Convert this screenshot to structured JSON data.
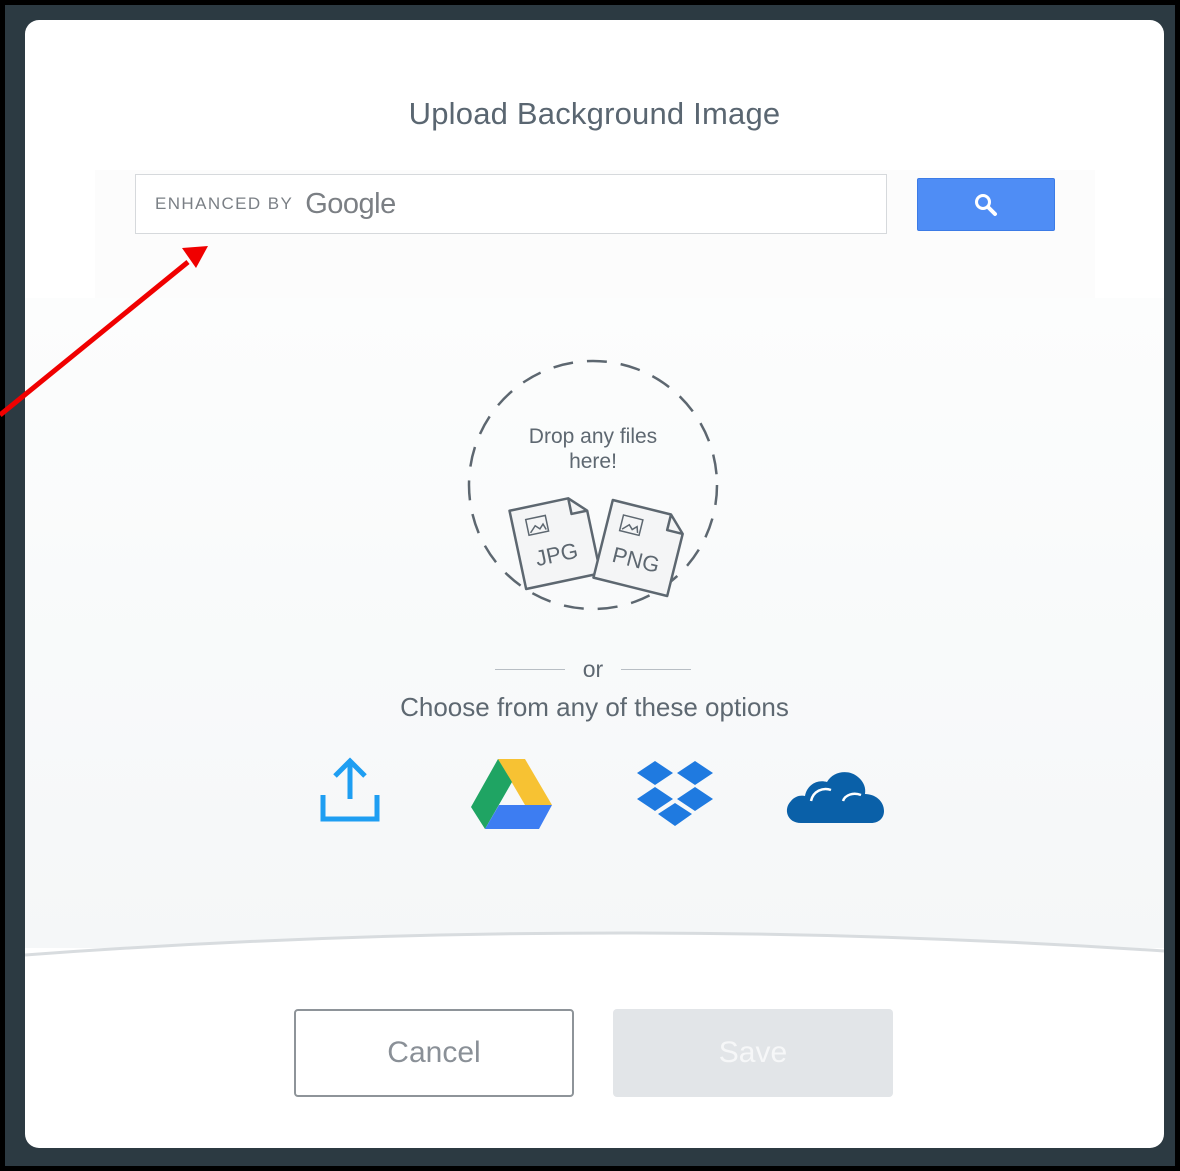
{
  "dialog": {
    "title": "Upload Background Image"
  },
  "search": {
    "enhanced_label": "ENHANCED BY",
    "brand": "Google",
    "button_icon": "search-icon"
  },
  "dropzone": {
    "text": "Drop any files here!",
    "file_type_1": "JPG",
    "file_type_2": "PNG"
  },
  "divider": {
    "or_label": "or"
  },
  "options": {
    "heading": "Choose from any of these options",
    "sources": [
      {
        "name": "upload",
        "icon": "upload-icon",
        "color": "#1e9ef2"
      },
      {
        "name": "google-drive",
        "icon": "google-drive-icon",
        "color": "#1fa463"
      },
      {
        "name": "dropbox",
        "icon": "dropbox-icon",
        "color": "#1f7ae0"
      },
      {
        "name": "onedrive",
        "icon": "onedrive-icon",
        "color": "#0a60a8"
      }
    ]
  },
  "footer": {
    "cancel_label": "Cancel",
    "save_label": "Save"
  },
  "colors": {
    "search_button": "#4f8df5",
    "annotation_arrow": "#f00000"
  }
}
